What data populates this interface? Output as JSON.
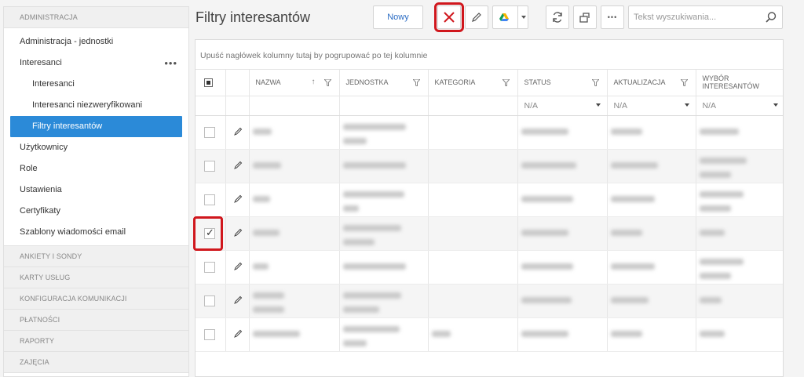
{
  "sidebar": {
    "sections": {
      "administracja": "ADMINISTRACJA",
      "ankiety": "ANKIETY I SONDY",
      "karty": "KARTY USŁUG",
      "konfiguracja": "KONFIGURACJA KOMUNIKACJI",
      "platnosci": "PŁATNOŚCI",
      "raporty": "RAPORTY",
      "zajecia": "ZAJĘCIA"
    },
    "items": {
      "jednostki": "Administracja - jednostki",
      "interesanci": "Interesanci",
      "interesanci_menu": "•••",
      "interesanci_sub": "Interesanci",
      "niezweryfikowani": "Interesanci niezweryfikowani",
      "filtry": "Filtry interesantów",
      "uzytkownicy": "Użytkownicy",
      "role": "Role",
      "ustawienia": "Ustawienia",
      "certyfikaty": "Certyfikaty",
      "szablony": "Szablony wiadomości email"
    }
  },
  "header": {
    "title": "Filtry interesantów",
    "new_label": "Nowy",
    "more_label": "•••",
    "search_placeholder": "Tekst wyszukiwania..."
  },
  "grid": {
    "group_hint": "Upuść nagłówek kolumny tutaj by pogrupować po tej kolumnie",
    "columns": {
      "nazwa": "NAZWA",
      "jednostka": "JEDNOSTKA",
      "kategoria": "KATEGORIA",
      "status": "STATUS",
      "aktualizacja": "AKTUALIZACJA",
      "wybor": "WYBÓR INTERESANTÓW"
    },
    "filters": {
      "status": "N/A",
      "aktualizacja": "N/A",
      "wybor": "N/A"
    },
    "sort_arrow": "↑",
    "rows": [
      {
        "checked": false
      },
      {
        "checked": false
      },
      {
        "checked": false
      },
      {
        "checked": true
      },
      {
        "checked": false
      },
      {
        "checked": false
      },
      {
        "checked": false
      }
    ]
  },
  "colors": {
    "accent": "#2b8ad8",
    "highlight": "#d0171d",
    "link": "#2b6cc4"
  }
}
